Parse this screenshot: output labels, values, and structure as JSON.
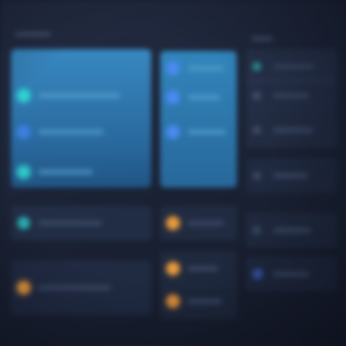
{
  "theme": {
    "background": "#1b2235",
    "highlight_blue": "#2f84c4",
    "accent_teal": "#2fc6c9",
    "accent_blue": "#3d7fe0",
    "accent_orange": "#e89a3c"
  },
  "columns": [
    {
      "id": "left",
      "rows": [
        {
          "state": "selected",
          "icon": "teal-status-dot"
        },
        {
          "state": "selected",
          "icon": "blue-status-dot"
        },
        {
          "state": "selected",
          "icon": "teal-status-dot"
        },
        {
          "state": "normal",
          "icon": "teal-status-dot"
        },
        {
          "state": "normal",
          "icon": "orange-status-dot"
        }
      ]
    },
    {
      "id": "middle",
      "rows": [
        {
          "state": "selected",
          "icon": "blue-status-dot"
        },
        {
          "state": "selected",
          "icon": "blue-status-dot"
        },
        {
          "state": "selected",
          "icon": "blue-status-dot"
        },
        {
          "state": "normal",
          "icon": "orange-status-dot"
        },
        {
          "state": "normal",
          "icon": "orange-status-dot"
        },
        {
          "state": "normal",
          "icon": "orange-status-dot"
        }
      ]
    },
    {
      "id": "right",
      "rows": [
        {
          "state": "normal",
          "icon": "teal-status-dot"
        },
        {
          "state": "normal",
          "icon": "gray-status-dot"
        },
        {
          "state": "normal",
          "icon": "gray-status-dot"
        },
        {
          "state": "normal",
          "icon": "gray-status-dot"
        },
        {
          "state": "normal",
          "icon": "gray-status-dot"
        },
        {
          "state": "normal",
          "icon": "blue-status-dot"
        }
      ]
    }
  ]
}
